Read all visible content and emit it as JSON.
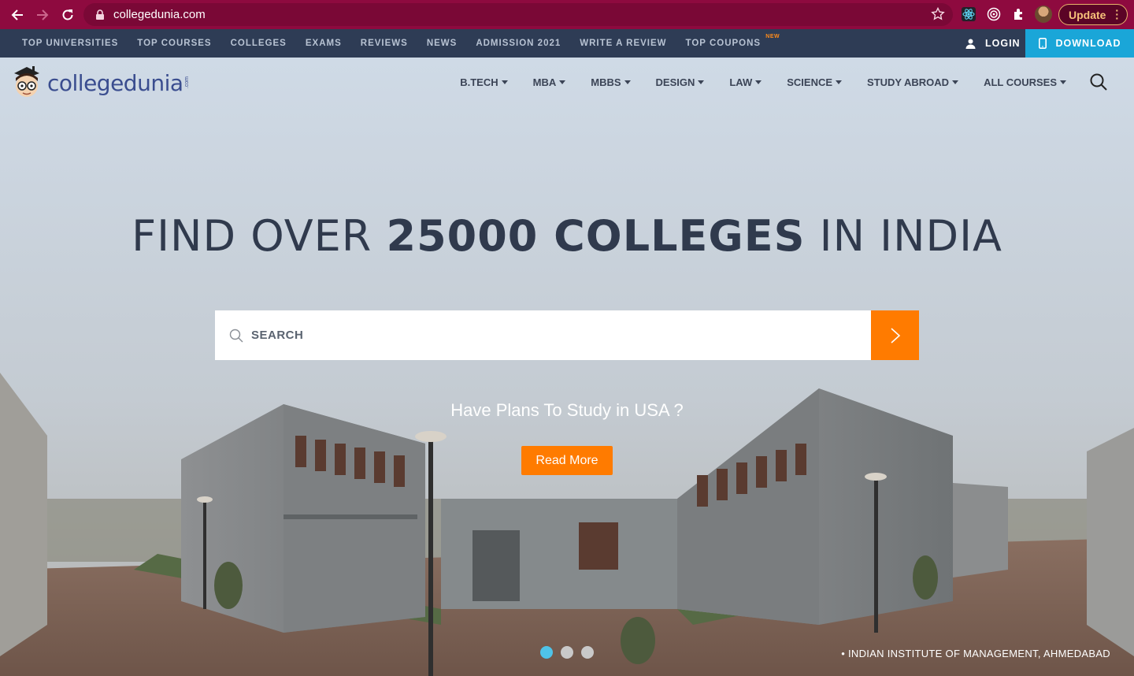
{
  "browser": {
    "url": "collegedunia.com",
    "update_label": "Update"
  },
  "topbar": {
    "links": [
      "TOP UNIVERSITIES",
      "TOP COURSES",
      "COLLEGES",
      "EXAMS",
      "REVIEWS",
      "NEWS",
      "ADMISSION 2021",
      "WRITE A REVIEW",
      "TOP COUPONS"
    ],
    "new_badge": "NEW",
    "login_label": "LOGIN",
    "download_label": "DOWNLOAD"
  },
  "header": {
    "logo_text": "collegedunia",
    "logo_suffix": ".com",
    "nav": [
      "B.TECH",
      "MBA",
      "MBBS",
      "DESIGN",
      "LAW",
      "SCIENCE",
      "STUDY ABROAD",
      "ALL COURSES"
    ]
  },
  "hero": {
    "headline_pre": "FIND OVER ",
    "headline_bold": "25000 COLLEGES",
    "headline_post": " IN INDIA",
    "search_placeholder": "SEARCH",
    "promo_text": "Have Plans To Study in USA ?",
    "read_more_label": "Read More",
    "caption": "• INDIAN INSTITUTE OF MANAGEMENT, AHMEDABAD",
    "slide_count": 3,
    "active_slide": 1
  },
  "colors": {
    "chrome": "#8e0a3f",
    "topbar": "#2e3c55",
    "download": "#1aa6d8",
    "accent": "#ff7b00",
    "logo": "#3a4d8f"
  }
}
